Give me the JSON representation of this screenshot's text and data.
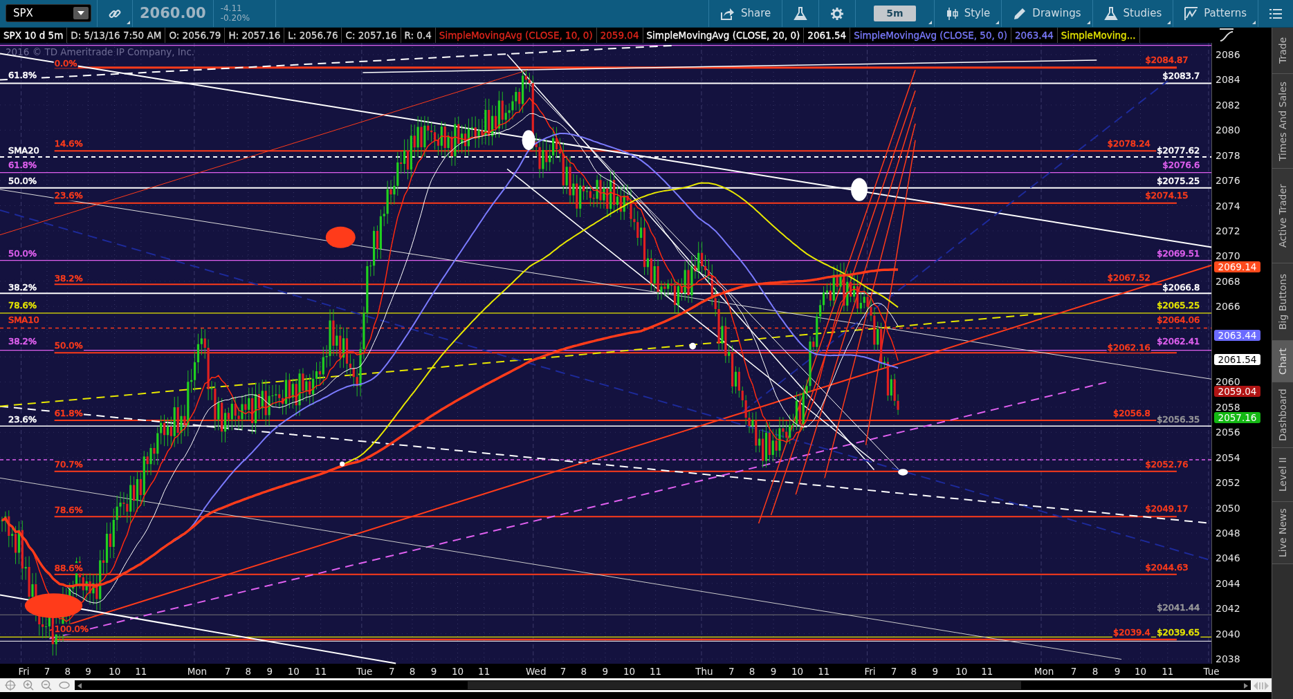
{
  "toolbar": {
    "symbol": "SPX",
    "last_price": "2060.00",
    "change": "-4.11",
    "change_percent": "-0.20%",
    "buttons": [
      {
        "kind": "share",
        "label": "Share"
      },
      {
        "kind": "flask"
      },
      {
        "kind": "gear"
      },
      {
        "kind": "timeframe",
        "label": "5m"
      },
      {
        "kind": "style",
        "label": "Style"
      },
      {
        "kind": "drawings",
        "label": "Drawings"
      },
      {
        "kind": "studies",
        "label": "Studies"
      },
      {
        "kind": "patterns",
        "label": "Patterns"
      },
      {
        "kind": "menu"
      }
    ]
  },
  "legend": [
    {
      "text": "SPX 10 d 5m",
      "color": "#ffffff"
    },
    {
      "text": "D: 5/13/16 7:50 AM",
      "color": "#d8d8d8"
    },
    {
      "text": "O: 2056.79",
      "color": "#d8d8d8"
    },
    {
      "text": "H: 2057.16",
      "color": "#d8d8d8"
    },
    {
      "text": "L: 2056.76",
      "color": "#d8d8d8"
    },
    {
      "text": "C: 2057.16",
      "color": "#d8d8d8"
    },
    {
      "text": "R: 0.4",
      "color": "#d8d8d8"
    },
    {
      "text": "SimpleMovingAvg (CLOSE, 10, 0)",
      "color": "#e3261c"
    },
    {
      "text": "2059.04",
      "color": "#e3261c"
    },
    {
      "text": "SimpleMovingAvg (CLOSE, 20, 0)",
      "color": "#ffffff"
    },
    {
      "text": "2061.54",
      "color": "#ffffff"
    },
    {
      "text": "SimpleMovingAvg (CLOSE, 50, 0)",
      "color": "#7b7bff"
    },
    {
      "text": "2063.44",
      "color": "#7b7bff"
    },
    {
      "text": "SimpleMoving...",
      "color": "#e8e800"
    }
  ],
  "chart": {
    "copyright": "2016 © TD Ameritrade IP Company, Inc.",
    "fib_labels": [
      {
        "text": "0.0%",
        "color": "#ff3b1a"
      },
      {
        "text": "61.8%",
        "color": "#ffffff"
      },
      {
        "text": "14.6%",
        "color": "#ff3b1a"
      },
      {
        "text": "SMA20",
        "color": "#ffffff"
      },
      {
        "text": "61.8%",
        "color": "#e060f0"
      },
      {
        "text": "50.0%",
        "color": "#ffffff"
      },
      {
        "text": "23.6%",
        "color": "#ff3b1a"
      },
      {
        "text": "50.0%",
        "color": "#e060f0"
      },
      {
        "text": "38.2%",
        "color": "#ff3b1a"
      },
      {
        "text": "38.2%",
        "color": "#ffffff"
      },
      {
        "text": "78.6%",
        "color": "#e8e800"
      },
      {
        "text": "SMA10",
        "color": "#ff3b1a"
      },
      {
        "text": "38.2%",
        "color": "#e060f0"
      },
      {
        "text": "50.0%",
        "color": "#ff3b1a"
      },
      {
        "text": "61.8%",
        "color": "#ff3b1a"
      },
      {
        "text": "23.6%",
        "color": "#ffffff"
      },
      {
        "text": "70.7%",
        "color": "#ff3b1a"
      },
      {
        "text": "78.6%",
        "color": "#ff3b1a"
      },
      {
        "text": "88.6%",
        "color": "#ff3b1a"
      },
      {
        "text": "100.0%",
        "color": "#ff3b1a"
      }
    ],
    "price_labels": [
      {
        "text": "$2084.87",
        "color": "#ff3b1a"
      },
      {
        "text": "$2083.7",
        "color": "#ffffff"
      },
      {
        "text": "$2078.24",
        "color": "#ff3b1a"
      },
      {
        "text": "$2077.62",
        "color": "#ffffff"
      },
      {
        "text": "$2076.6",
        "color": "#e060f0"
      },
      {
        "text": "$2075.25",
        "color": "#ffffff"
      },
      {
        "text": "$2074.15",
        "color": "#ff3b1a"
      },
      {
        "text": "$2069.51",
        "color": "#e060f0"
      },
      {
        "text": "$2067.52",
        "color": "#ff3b1a"
      },
      {
        "text": "$2066.8",
        "color": "#ffffff"
      },
      {
        "text": "$2065.25",
        "color": "#e8e800"
      },
      {
        "text": "$2064.06",
        "color": "#ff3b1a"
      },
      {
        "text": "$2062.41",
        "color": "#e060f0"
      },
      {
        "text": "$2062.16",
        "color": "#ff3b1a"
      },
      {
        "text": "$2056.8",
        "color": "#ff3b1a"
      },
      {
        "text": "$2056.35",
        "color": "#9a9a9a"
      },
      {
        "text": "$2052.76",
        "color": "#ff3b1a"
      },
      {
        "text": "$2049.17",
        "color": "#ff3b1a"
      },
      {
        "text": "$2044.63",
        "color": "#ff3b1a"
      },
      {
        "text": "$2041.44",
        "color": "#9a9a9a"
      },
      {
        "text": "$2039.4",
        "color": "#ff3b1a"
      },
      {
        "text": "$2039.65",
        "color": "#e8e800"
      }
    ],
    "price_axis": [
      "2086",
      "2084",
      "2082",
      "2080",
      "2078",
      "2076",
      "2074",
      "2072",
      "2070",
      "2068",
      "2066",
      "2060",
      "2058",
      "2056",
      "2054",
      "2052",
      "2050",
      "2048",
      "2046",
      "2044",
      "2042",
      "2040",
      "2038"
    ],
    "price_badges": [
      {
        "text": "2069.14",
        "color": "#ff4a1c"
      },
      {
        "text": "2063.44",
        "color": "#6b6bff"
      },
      {
        "text": "2061.54",
        "color": "#ffffff"
      },
      {
        "text": "2059.04",
        "color": "#b01414"
      },
      {
        "text": "2057.16",
        "color": "#14b814"
      }
    ],
    "time_axis": [
      "Fri",
      "7",
      "8",
      "9",
      "10",
      "11",
      "Mon",
      "7",
      "8",
      "9",
      "10",
      "11",
      "Tue",
      "7",
      "8",
      "9",
      "10",
      "11",
      "Wed",
      "7",
      "8",
      "9",
      "10",
      "11",
      "Thu",
      "7",
      "8",
      "9",
      "10",
      "11",
      "Fri",
      "7",
      "8",
      "9",
      "10",
      "11",
      "Mon",
      "7",
      "8",
      "9",
      "10",
      "11",
      "Tue"
    ]
  },
  "side_tabs": [
    {
      "label": "Trade",
      "selected": false
    },
    {
      "label": "Times And Sales",
      "selected": false
    },
    {
      "label": "Active Trader",
      "selected": false
    },
    {
      "label": "Big Buttons",
      "selected": false
    },
    {
      "label": "Chart",
      "selected": true
    },
    {
      "label": "Dashboard",
      "selected": false
    },
    {
      "label": "Level II",
      "selected": false
    },
    {
      "label": "Live News",
      "selected": false
    }
  ]
}
